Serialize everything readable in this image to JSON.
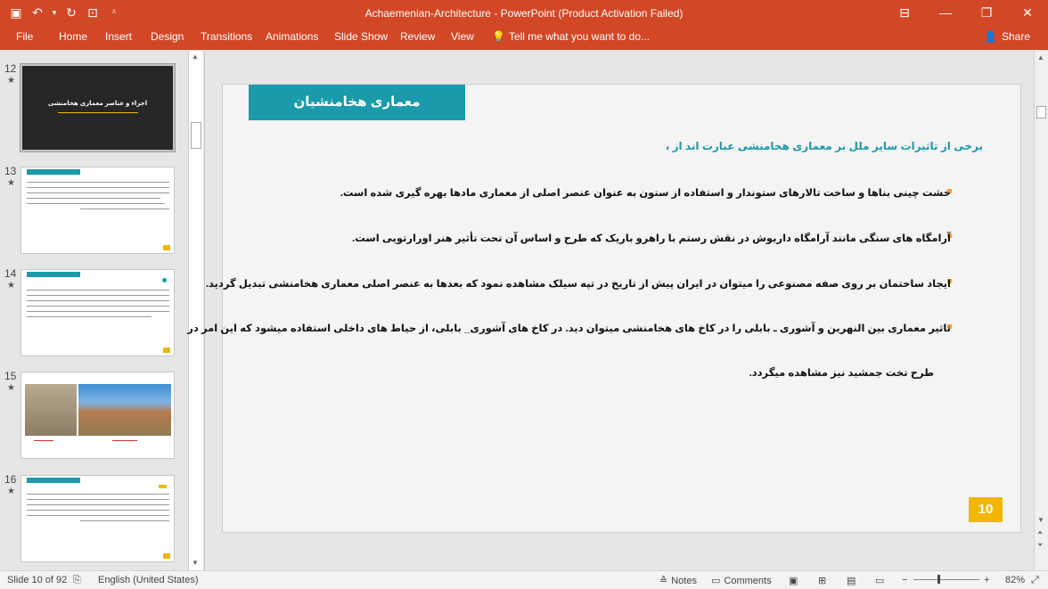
{
  "window": {
    "title": "Achaemenian-Architecture - PowerPoint (Product Activation Failed)"
  },
  "ribbon": {
    "tabs": [
      "File",
      "Home",
      "Insert",
      "Design",
      "Transitions",
      "Animations",
      "Slide Show",
      "Review",
      "View"
    ],
    "tell_me": "Tell me what you want to do...",
    "share": "Share"
  },
  "thumbnails": [
    {
      "num": "12",
      "star": "★",
      "title": "اجزاء و عناصر معماری هخامنشی"
    },
    {
      "num": "13",
      "star": "★"
    },
    {
      "num": "14",
      "star": "★"
    },
    {
      "num": "15",
      "star": "★"
    },
    {
      "num": "16",
      "star": "★"
    }
  ],
  "slide": {
    "header": "معماری هخامنشیان",
    "subtitle": "برخی از تاثیرات سایر ملل بر معماری هخامنشی عبارت اند از ،",
    "bullets": [
      "خشت چینی بناها و ساخت تالارهای ستوندار و استفاده از ستون به عنوان عنصر اصلی از معماری مادها بهره گیری شده است.",
      "آرامگاه های سنگی مانند آرامگاه داریوش در نقش رستم با راهرو باریک که طرح و اساس آن تحت تأثیر هنر اورارتویی است.",
      "ایجاد ساختمان بر روی صفه مصنوعی را میتوان در ایران پیش از تاریخ در تپه سیلک مشاهده نمود که بعدها به عنصر اصلی معماری هخامنشی تبدیل گردید.",
      "تاثیر معماری بین النهرین و آشوری ـ بابلی را در کاخ های هخامنشی میتوان دید. در کاخ های آشوری_ بابلی، از حیاط های داخلی استفاده میشود که این امر در"
    ],
    "continuation": "طرح تخت جمشید نیز مشاهده میگردد.",
    "page_number": "10"
  },
  "status": {
    "slide_of": "Slide 10 of 92",
    "language": "English (United States)",
    "notes": "Notes",
    "comments": "Comments",
    "zoom": "82%"
  },
  "colors": {
    "accent": "#d24726",
    "teal": "#1a9aaa",
    "yellow": "#f2b705"
  }
}
